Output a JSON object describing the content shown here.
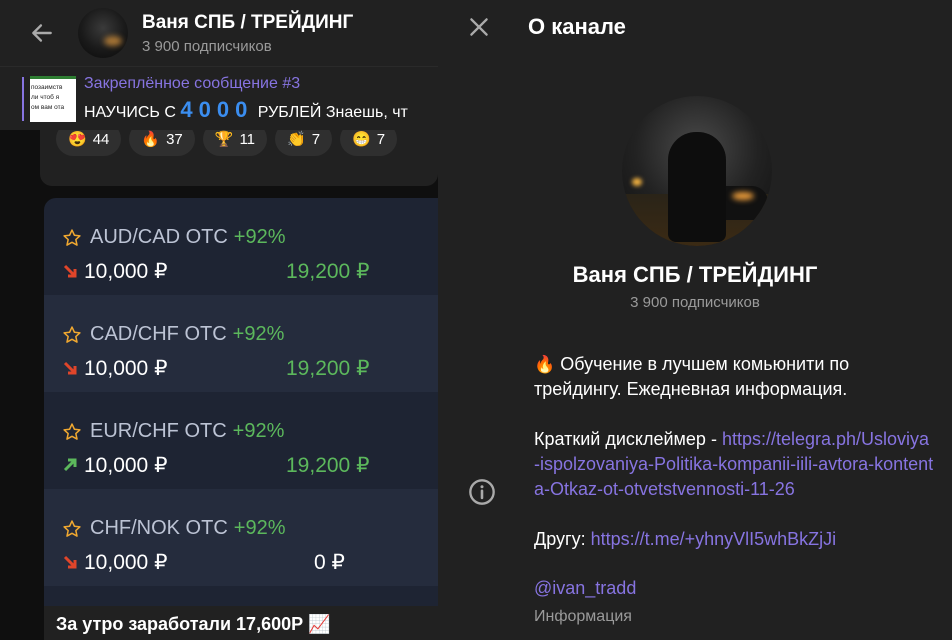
{
  "chat": {
    "header": {
      "title": "Ваня СПБ / ТРЕЙДИНГ",
      "subscribers": "3 900 подписчиков"
    },
    "pinned": {
      "title": "Закреплённое сообщение #3",
      "text_before": "НАУЧИСЬ С ",
      "big_number": "4000",
      "text_after": " РУБЛЕЙ Знаешь, чт",
      "thumb_lines": [
        "позаимств",
        "ли чтоб я",
        "ом вам ота"
      ]
    },
    "reactions": [
      {
        "emoji": "😍",
        "count": "44"
      },
      {
        "emoji": "🔥",
        "count": "37"
      },
      {
        "emoji": "🏆",
        "count": "11"
      },
      {
        "emoji": "👏",
        "count": "7"
      },
      {
        "emoji": "😁",
        "count": "7"
      }
    ],
    "signals": [
      {
        "pair": "AUD/CAD OTC",
        "pct": "+92%",
        "direction": "down",
        "stake": "10,000 ₽",
        "payout": "19,200 ₽"
      },
      {
        "pair": "CAD/CHF OTC",
        "pct": "+92%",
        "direction": "down",
        "stake": "10,000 ₽",
        "payout": "19,200 ₽"
      },
      {
        "pair": "EUR/CHF OTC",
        "pct": "+92%",
        "direction": "up",
        "stake": "10,000 ₽",
        "payout": "19,200 ₽"
      },
      {
        "pair": "CHF/NOK OTC",
        "pct": "+92%",
        "direction": "down",
        "stake": "10,000 ₽",
        "payout": "0 ₽"
      }
    ],
    "caption": "За утро заработали 17,600Р 📈"
  },
  "info": {
    "panel_title": "О канале",
    "channel_name": "Ваня СПБ / ТРЕЙДИНГ",
    "subscribers": "3 900 подписчиков",
    "description_line": "Обучение в лучшем комьюнити по трейдингу. Ежедневная информация.",
    "disclaimer_label": "Краткий дисклеймер - ",
    "disclaimer_link": "https://telegra.ph/Usloviya-ispolzovaniya-Politika-kompanii-iili-avtora-kontenta-Otkaz-ot-otvetstvennosti-11-26",
    "friend_label": "Другу: ",
    "friend_link": "https://t.me/+yhnyVlI5whBkZjJi",
    "username": "@ivan_tradd",
    "label": "Информация"
  },
  "colors": {
    "accent": "#8774e1",
    "profit": "#5cb85c",
    "loss_arrow": "#e0452a",
    "gain_arrow": "#5cb85c",
    "star": "#f0a830"
  }
}
